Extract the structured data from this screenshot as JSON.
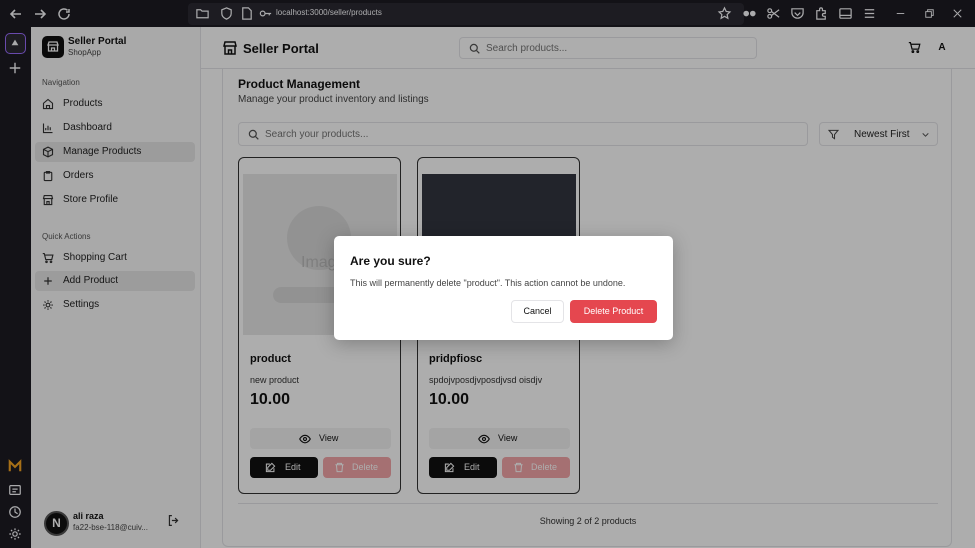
{
  "browser": {
    "url": "localhost:3000/seller/products"
  },
  "sidebar": {
    "brand_title": "Seller Portal",
    "brand_subtitle": "ShopApp",
    "nav_section_label": "Navigation",
    "nav_items": [
      {
        "label": "Products",
        "icon": "home-icon"
      },
      {
        "label": "Dashboard",
        "icon": "bar-chart-icon"
      },
      {
        "label": "Manage Products",
        "icon": "package-icon",
        "active": true
      },
      {
        "label": "Orders",
        "icon": "clipboard-icon"
      },
      {
        "label": "Store Profile",
        "icon": "store-icon"
      }
    ],
    "quick_section_label": "Quick Actions",
    "quick_items": [
      {
        "label": "Shopping Cart",
        "icon": "cart-icon"
      },
      {
        "label": "Add Product",
        "icon": "plus-icon",
        "active": true
      },
      {
        "label": "Settings",
        "icon": "gear-icon"
      }
    ],
    "user": {
      "avatar_letter": "N",
      "name": "ali raza",
      "email": "fa22-bse-118@cuiv..."
    }
  },
  "header": {
    "title": "Seller Portal",
    "search_placeholder": "Search products...",
    "avatar_letter": "A"
  },
  "main": {
    "title": "Product Management",
    "subtitle": "Manage your product inventory and listings",
    "search_placeholder": "Search your products...",
    "sort_label": "Newest First",
    "products": [
      {
        "name": "product",
        "description": "new product",
        "price": "10.00",
        "image_placeholder": "Imag"
      },
      {
        "name": "pridpfiosc",
        "description": "spdojvposdjvposdjvsd oisdjv",
        "price": "10.00"
      }
    ],
    "view_label": "View",
    "edit_label": "Edit",
    "delete_label": "Delete",
    "footer_text": "Showing 2 of 2 products"
  },
  "dialog": {
    "title": "Are you sure?",
    "message": "This will permanently delete \"product\". This action cannot be undone.",
    "cancel_label": "Cancel",
    "confirm_label": "Delete Product"
  },
  "colors": {
    "destructive": "#e5474f",
    "primary": "#111111",
    "browser_bg": "#1c1b22"
  }
}
